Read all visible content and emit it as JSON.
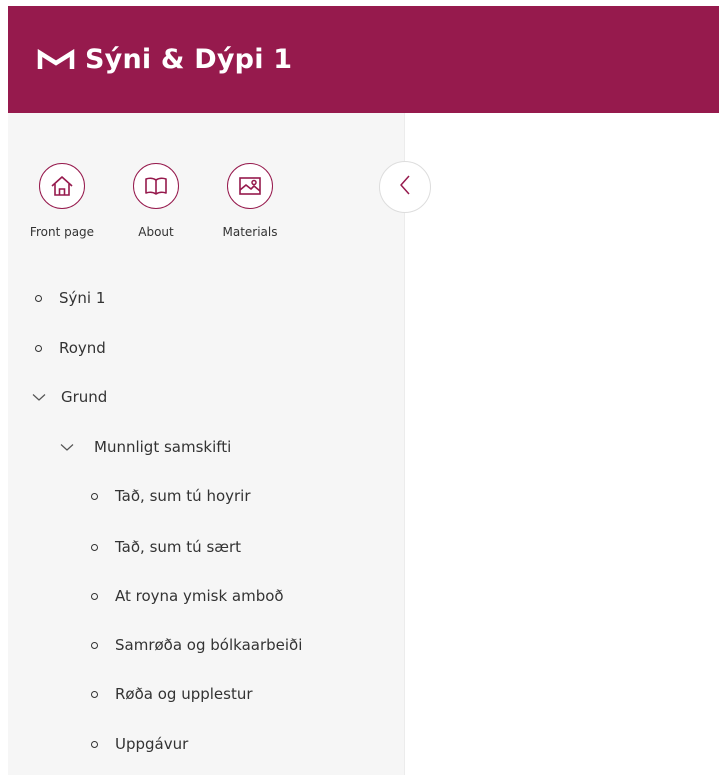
{
  "app": {
    "title": "Sýni & Dýpi 1",
    "brand_color": "#961a4d",
    "logo_icon": "m-logo-icon"
  },
  "quicklinks": [
    {
      "label": "Front page",
      "icon": "home-icon"
    },
    {
      "label": "About",
      "icon": "book-icon"
    },
    {
      "label": "Materials",
      "icon": "image-icon"
    }
  ],
  "sidebar": {
    "collapse_icon": "chevron-left-icon",
    "items": [
      {
        "label": "Sýni 1",
        "type": "leaf",
        "level": 0
      },
      {
        "label": "Roynd",
        "type": "leaf",
        "level": 0
      },
      {
        "label": "Grund",
        "type": "expanded",
        "level": 0
      },
      {
        "label": "Munnligt samskifti",
        "type": "expanded",
        "level": 1
      },
      {
        "label": "Tað, sum tú hoyrir",
        "type": "leaf",
        "level": 2
      },
      {
        "label": "Tað, sum tú sært",
        "type": "leaf",
        "level": 2
      },
      {
        "label": "At royna ymisk amboð",
        "type": "leaf",
        "level": 2
      },
      {
        "label": "Samrøða og bólkaarbeiði",
        "type": "leaf",
        "level": 2
      },
      {
        "label": "Røða og upplestur",
        "type": "leaf",
        "level": 2
      },
      {
        "label": "Uppgávur",
        "type": "leaf",
        "level": 2
      }
    ]
  }
}
